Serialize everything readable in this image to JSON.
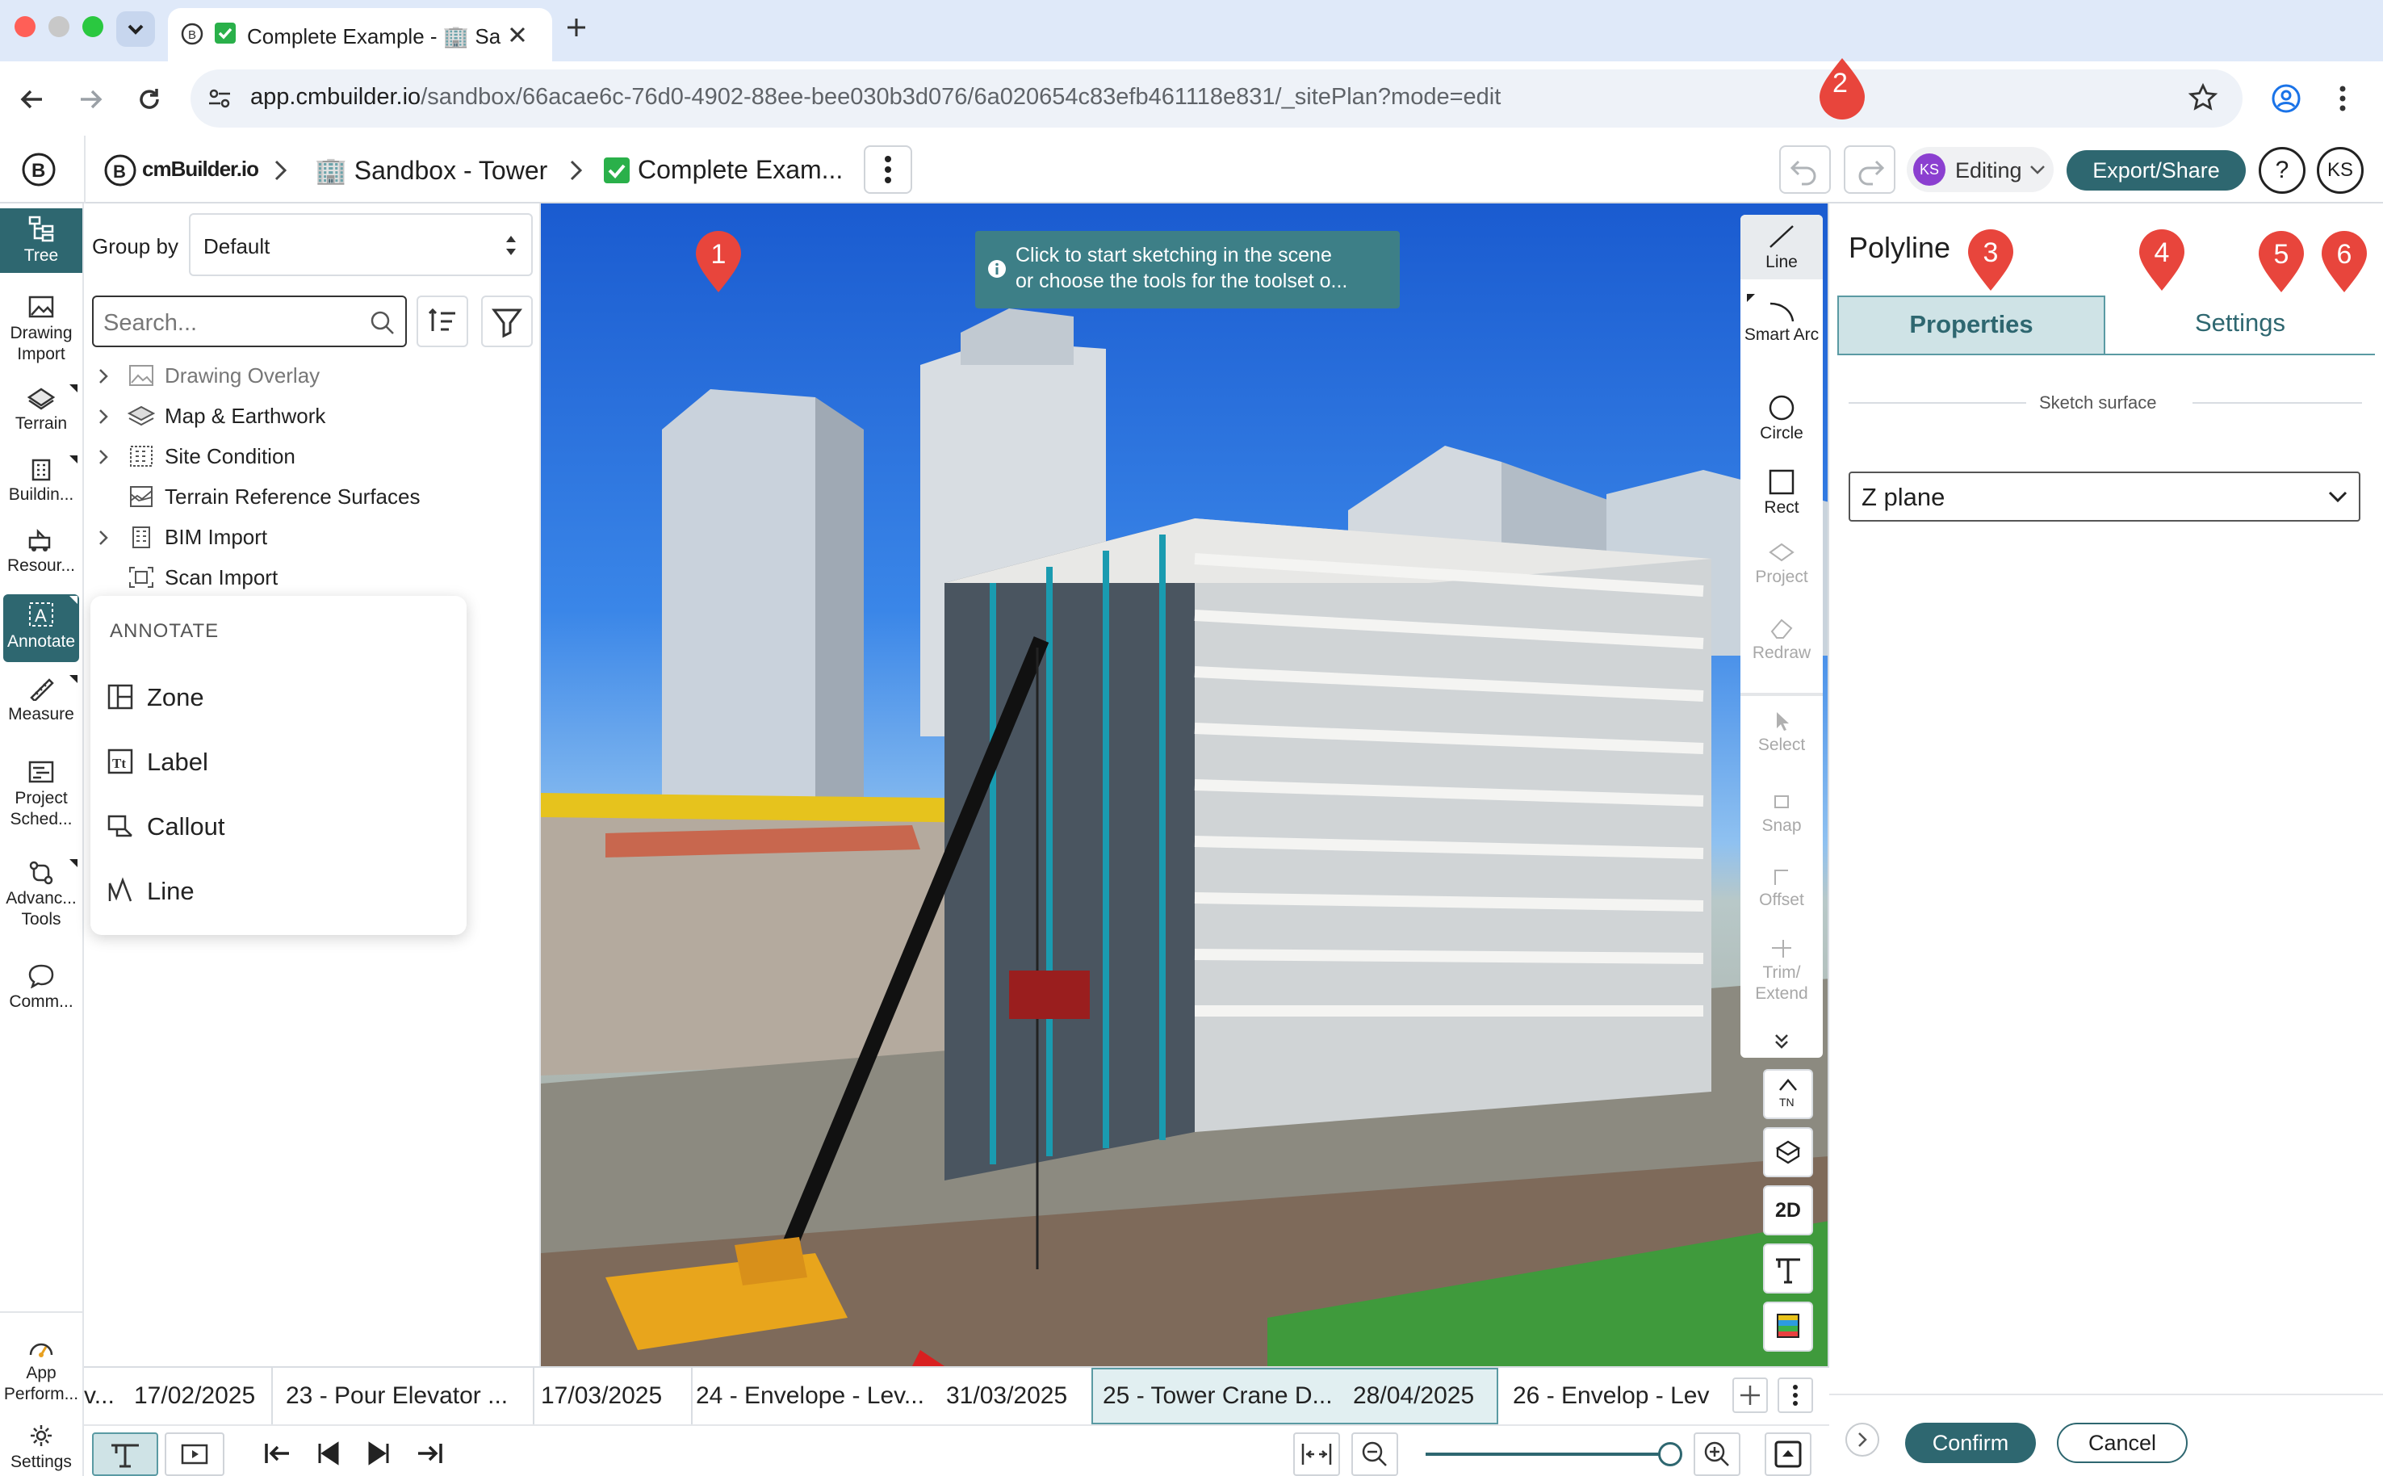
{
  "browser": {
    "tab_title": "Complete Example - 🏢 Sa",
    "url_host": "app.cmbuilder.io",
    "url_path": "/sandbox/66acae6c-76d0-4902-88ee-bee030b3d076/6a020654c83efb461118e831/_sitePlan?mode=edit"
  },
  "header": {
    "logo_text": "cmBuilder.io",
    "breadcrumb_sandbox": "🏢 Sandbox - Tower",
    "breadcrumb_page": "Complete Exam...",
    "editing_label": "Editing",
    "editing_avatar": "KS",
    "export_label": "Export/Share",
    "help_label": "?",
    "user_avatar": "KS"
  },
  "rail": {
    "items": [
      {
        "label": "Tree",
        "icon": "tree-icon"
      },
      {
        "label": "Drawing Import",
        "icon": "drawing-import-icon"
      },
      {
        "label": "Terrain",
        "icon": "terrain-icon"
      },
      {
        "label": "Buildin...",
        "icon": "building-icon"
      },
      {
        "label": "Resour...",
        "icon": "resources-icon"
      },
      {
        "label": "Annotate",
        "icon": "annotate-icon"
      },
      {
        "label": "Measure",
        "icon": "measure-icon"
      },
      {
        "label": "Project Sched...",
        "icon": "schedule-icon"
      },
      {
        "label": "Advanc... Tools",
        "icon": "advanced-tools-icon"
      },
      {
        "label": "Comm...",
        "icon": "comment-icon"
      }
    ],
    "bottom": [
      {
        "label": "App Perform...",
        "icon": "performance-icon"
      },
      {
        "label": "Settings",
        "icon": "gear-icon"
      }
    ]
  },
  "tree": {
    "group_by_label": "Group by",
    "group_by_value": "Default",
    "search_placeholder": "Search...",
    "rows": [
      {
        "label": "Drawing Overlay",
        "expandable": true
      },
      {
        "label": "Map & Earthwork",
        "expandable": true
      },
      {
        "label": "Site Condition",
        "expandable": true
      },
      {
        "label": "Terrain Reference Surfaces",
        "expandable": false
      },
      {
        "label": "BIM Import",
        "expandable": true
      },
      {
        "label": "Scan Import",
        "expandable": false
      }
    ]
  },
  "annotate_menu": {
    "title": "ANNOTATE",
    "items": [
      "Zone",
      "Label",
      "Callout",
      "Line"
    ]
  },
  "scene": {
    "hint_line1": "Click to start sketching in the scene",
    "hint_line2": "or choose the tools for the toolset o..."
  },
  "sketch_toolbar": {
    "tools": [
      {
        "label": "Line",
        "enabled": true
      },
      {
        "label": "Smart Arc",
        "enabled": true
      },
      {
        "label": "Circle",
        "enabled": true
      },
      {
        "label": "Rect",
        "enabled": true
      },
      {
        "label": "Project",
        "enabled": false
      },
      {
        "label": "Redraw",
        "enabled": false
      },
      {
        "label": "Select",
        "enabled": false
      },
      {
        "label": "Snap",
        "enabled": false
      },
      {
        "label": "Offset",
        "enabled": false
      },
      {
        "label": "Trim/ Extend",
        "enabled": false
      }
    ],
    "view_buttons": [
      "TN",
      "2D"
    ]
  },
  "panel": {
    "title": "Polyline",
    "tab_properties": "Properties",
    "tab_settings": "Settings",
    "section_label": "Sketch surface",
    "surface_value": "Z plane",
    "confirm_label": "Confirm",
    "cancel_label": "Cancel"
  },
  "timeline": {
    "cells": [
      {
        "text": "v...",
        "active": false
      },
      {
        "text": "17/02/2025",
        "active": false
      },
      {
        "text": "23 - Pour Elevator ...",
        "active": false
      },
      {
        "text": "17/03/2025",
        "active": false
      },
      {
        "text": "24 - Envelope - Lev...",
        "active": false
      },
      {
        "text": "31/03/2025",
        "active": false
      },
      {
        "text": "25 - Tower Crane D...",
        "active": true
      },
      {
        "text": "28/04/2025",
        "active": true
      },
      {
        "text": "26 - Envelop - Lev",
        "active": false
      }
    ]
  },
  "callouts": [
    "1",
    "2",
    "3",
    "4",
    "5",
    "6"
  ],
  "colors": {
    "accent": "#2e6770",
    "callout": "#e8453c",
    "active_tab": "#cfe3e6"
  }
}
